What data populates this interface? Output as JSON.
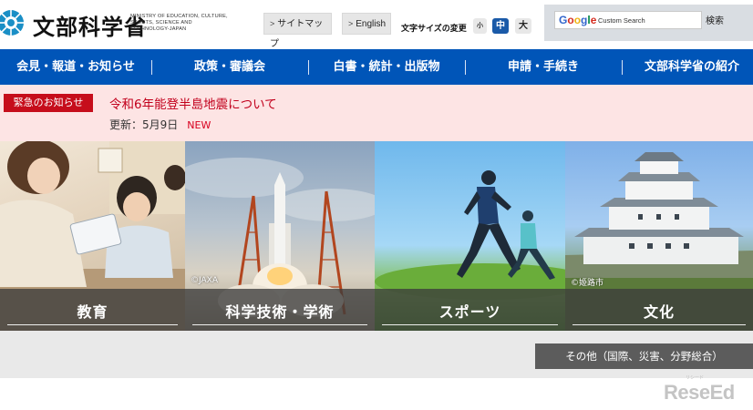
{
  "header": {
    "logo_jp": "文部科学省",
    "logo_en": "MINISTRY OF EDUCATION, CULTURE, SPORTS, SCIENCE AND TECHNOLOGY-JAPAN",
    "sitemap_label": "サイトマップ",
    "english_label": "English",
    "font_size_label": "文字サイズの変更",
    "font_size_options": [
      "小",
      "中",
      "大"
    ],
    "font_size_selected": "中",
    "search": {
      "logo_text": "Google",
      "placeholder": "Custom Search",
      "button_label": "検索"
    }
  },
  "nav": {
    "items": [
      {
        "label": "会見・報道・お知らせ"
      },
      {
        "label": "政策・審議会"
      },
      {
        "label": "白書・統計・出版物"
      },
      {
        "label": "申請・手続き"
      },
      {
        "label": "文部科学省の紹介"
      }
    ]
  },
  "notice": {
    "tag": "緊急のお知らせ",
    "link_text": "令和6年能登半島地震について",
    "updated": "更新：5月9日",
    "new_badge": "NEW"
  },
  "tiles": [
    {
      "label": "教育",
      "credit": ""
    },
    {
      "label": "科学技術・学術",
      "credit": "©JAXA"
    },
    {
      "label": "スポーツ",
      "credit": ""
    },
    {
      "label": "文化",
      "credit": "©姫路市"
    }
  ],
  "other_button": "その他（国際、災害、分野総合）",
  "watermark": {
    "text": "ReseEd",
    "sub": "リシード"
  },
  "colors": {
    "nav_bg": "#0055b8",
    "notice_bg": "#fde4e4",
    "notice_tag": "#c60d1b",
    "tile_band": "#3c3c3c"
  }
}
